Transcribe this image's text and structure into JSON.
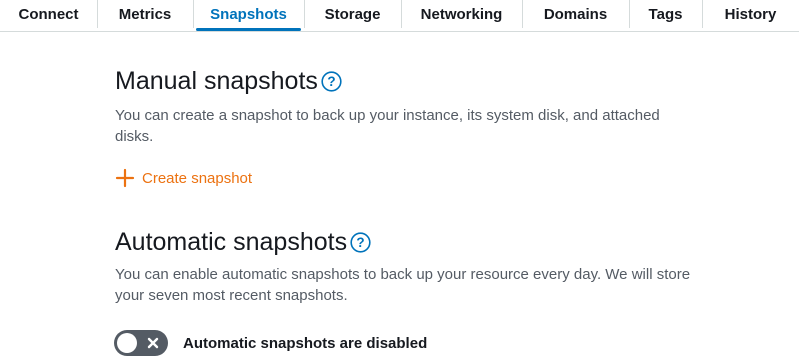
{
  "tabs": [
    {
      "label": "Connect"
    },
    {
      "label": "Metrics"
    },
    {
      "label": "Snapshots"
    },
    {
      "label": "Storage"
    },
    {
      "label": "Networking"
    },
    {
      "label": "Domains"
    },
    {
      "label": "Tags"
    },
    {
      "label": "History"
    }
  ],
  "active_tab": "Snapshots",
  "manual": {
    "title": "Manual snapshots",
    "help_icon": "question-circle-icon",
    "description": "You can create a snapshot to back up your instance, its system disk, and attached disks.",
    "create_icon": "plus-icon",
    "create_label": "Create snapshot"
  },
  "automatic": {
    "title": "Automatic snapshots",
    "help_icon": "question-circle-icon",
    "description": "You can enable automatic snapshots to back up your resource every day. We will store your seven most recent snapshots.",
    "toggle_enabled": false,
    "toggle_label": "Automatic snapshots are disabled"
  },
  "colors": {
    "accent_blue": "#0073bb",
    "accent_orange": "#ec7211",
    "text_dark": "#16191f",
    "text_muted": "#545b64",
    "toggle_off": "#545b64",
    "divider": "#d5dbdb"
  }
}
